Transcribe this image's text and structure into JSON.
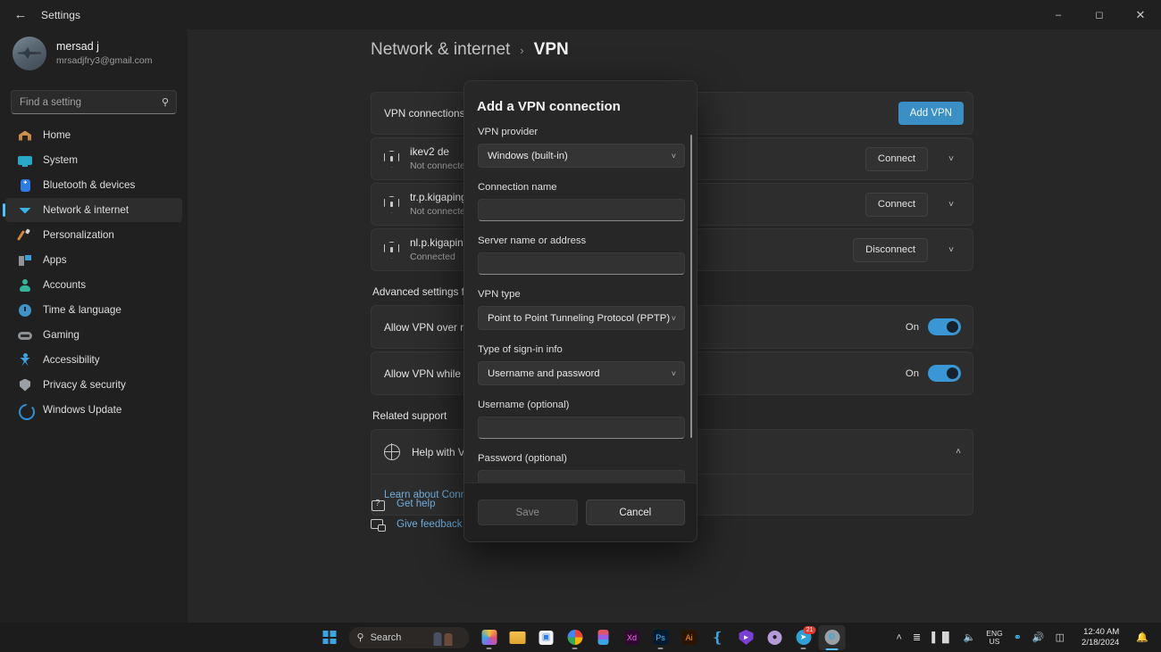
{
  "titlebar": {
    "back_icon": "arrow-left-icon",
    "title": "Settings",
    "minimize": "–",
    "maximize": "❐",
    "close": "✕"
  },
  "sidebar": {
    "account": {
      "name": "mersad j",
      "email": "mrsadjfry3@gmail.com",
      "avatar_alt": "user-avatar"
    },
    "search": {
      "placeholder": "Find a setting",
      "value": "",
      "icon": "search-icon"
    },
    "items": [
      {
        "label": "Home",
        "icon": "home-icon",
        "active": false
      },
      {
        "label": "System",
        "icon": "system-icon",
        "active": false
      },
      {
        "label": "Bluetooth & devices",
        "icon": "bluetooth-icon",
        "active": false
      },
      {
        "label": "Network & internet",
        "icon": "wifi-icon",
        "active": true
      },
      {
        "label": "Personalization",
        "icon": "paintbrush-icon",
        "active": false
      },
      {
        "label": "Apps",
        "icon": "apps-icon",
        "active": false
      },
      {
        "label": "Accounts",
        "icon": "account-icon",
        "active": false
      },
      {
        "label": "Time & language",
        "icon": "clock-icon",
        "active": false
      },
      {
        "label": "Gaming",
        "icon": "gamepad-icon",
        "active": false
      },
      {
        "label": "Accessibility",
        "icon": "accessibility-icon",
        "active": false
      },
      {
        "label": "Privacy & security",
        "icon": "shield-icon",
        "active": false
      },
      {
        "label": "Windows Update",
        "icon": "update-icon",
        "active": false
      }
    ]
  },
  "breadcrumb": {
    "parent": "Network & internet",
    "separator": "›",
    "current": "VPN"
  },
  "vpn_section": {
    "header_label": "VPN connections",
    "add_button": "Add VPN",
    "connections": [
      {
        "name": "ikev2 de",
        "status": "Not connected",
        "action": "Connect",
        "icon": "vpn-shield-icon",
        "expand": "˅"
      },
      {
        "name": "tr.p.kigaping.inf",
        "status": "Not connected",
        "action": "Connect",
        "icon": "vpn-shield-icon",
        "expand": "˅"
      },
      {
        "name": "nl.p.kigaping.inf",
        "status": "Connected",
        "action": "Disconnect",
        "icon": "vpn-shield-icon",
        "expand": "˅"
      }
    ]
  },
  "advanced": {
    "title": "Advanced settings for all VPN connections",
    "rows": [
      {
        "label": "Allow VPN over metered networks",
        "state": "On",
        "enabled": true
      },
      {
        "label": "Allow VPN while roaming",
        "state": "On",
        "enabled": true
      }
    ]
  },
  "related_support": {
    "title": "Related support",
    "help_label": "Help with VPN",
    "help_icon": "globe-icon",
    "collapse_icon": "˄",
    "link": "Learn about Connecting to a VPN"
  },
  "footer_links": [
    {
      "label": "Get help",
      "icon": "help-icon"
    },
    {
      "label": "Give feedback",
      "icon": "feedback-icon"
    }
  ],
  "modal": {
    "title": "Add a VPN connection",
    "fields": [
      {
        "label": "VPN provider",
        "type": "select",
        "value": "Windows (built-in)",
        "chevron": "˅"
      },
      {
        "label": "Connection name",
        "type": "input",
        "value": ""
      },
      {
        "label": "Server name or address",
        "type": "input",
        "value": ""
      },
      {
        "label": "VPN type",
        "type": "select",
        "value": "Point to Point Tunneling Protocol (PPTP)",
        "chevron": "˅"
      },
      {
        "label": "Type of sign-in info",
        "type": "select",
        "value": "Username and password",
        "chevron": "˅"
      },
      {
        "label": "Username (optional)",
        "type": "input",
        "value": ""
      },
      {
        "label": "Password (optional)",
        "type": "input",
        "value": ""
      }
    ],
    "save_label": "Save",
    "save_disabled": true,
    "cancel_label": "Cancel"
  },
  "taskbar": {
    "start_icon": "windows-start-icon",
    "search": {
      "label": "Search",
      "icon": "search-icon"
    },
    "apps": [
      {
        "name": "photos-icon",
        "running": true
      },
      {
        "name": "file-explorer-icon",
        "running": false
      },
      {
        "name": "microsoft-store-icon",
        "running": false
      },
      {
        "name": "chrome-icon",
        "running": true
      },
      {
        "name": "figma-icon",
        "running": false
      },
      {
        "name": "adobe-xd-icon",
        "running": false
      },
      {
        "name": "photoshop-icon",
        "running": true
      },
      {
        "name": "illustrator-icon",
        "running": false
      },
      {
        "name": "vscode-icon",
        "running": false
      },
      {
        "name": "shield-app-icon",
        "running": false
      },
      {
        "name": "github-icon",
        "running": false
      },
      {
        "name": "telegram-icon",
        "running": true,
        "badge": "21"
      },
      {
        "name": "settings-icon",
        "running": true,
        "active": true
      }
    ],
    "tray": {
      "chevron": "˄",
      "sliders_icon": "sliders-icon",
      "equalizer_icon": "equalizer-icon",
      "mic_icon": "microphone-icon",
      "language": {
        "line1": "ENG",
        "line2": "US"
      },
      "network_icon": "network-icon",
      "volume_icon": "volume-icon",
      "battery_icon": "battery-icon",
      "clock": {
        "time": "12:40 AM",
        "date": "2/18/2024"
      },
      "notification_icon": "bell-icon"
    }
  },
  "colors": {
    "accent": "#4cc2ff",
    "button_blue": "#3a8fc4",
    "toggle_on": "#3a96d4",
    "link": "#70aede"
  }
}
